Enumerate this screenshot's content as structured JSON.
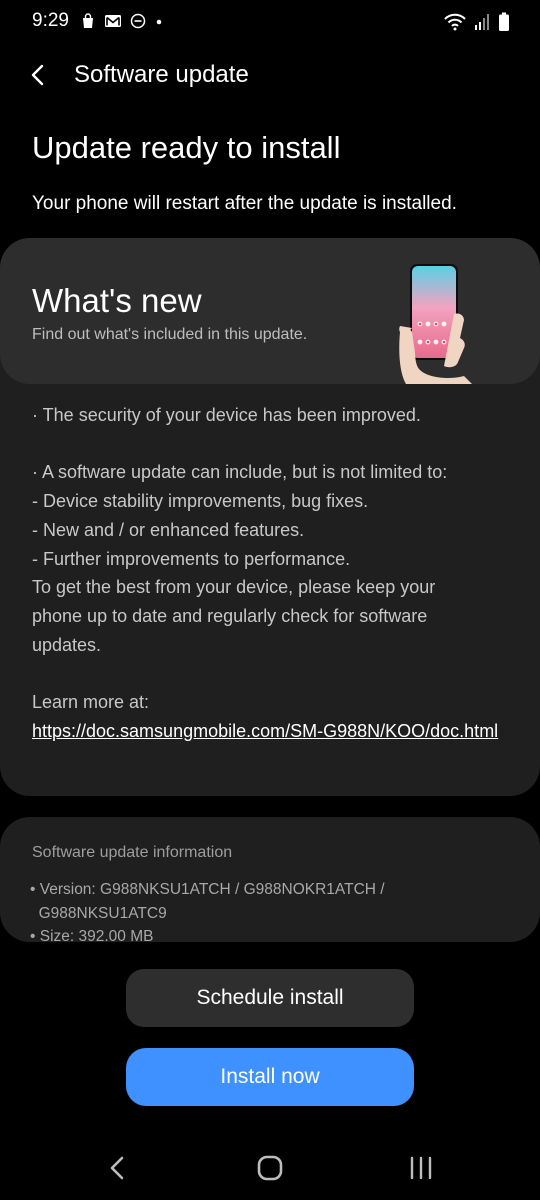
{
  "status_bar": {
    "time": "9:29",
    "left_icons": [
      "shopping-bag-icon",
      "gmail-icon",
      "do-not-disturb-icon",
      "dot-icon"
    ],
    "right_icons": [
      "wifi-icon",
      "signal-icon",
      "battery-icon"
    ]
  },
  "header": {
    "title": "Software update"
  },
  "headline": "Update ready to install",
  "subline": "Your phone will restart after the update is installed.",
  "whats_new": {
    "title": "What's new",
    "subtitle": "Find out what's included in this update.",
    "lines": {
      "security": "· The security of your device has been improved.",
      "intro": "· A software update can include, but is not limited to:",
      "item1": " - Device stability improvements, bug fixes.",
      "item2": " - New and / or enhanced features.",
      "item3": " - Further improvements to performance.",
      "advice1": "To get the best from your device, please keep your",
      "advice2": "phone up to date and regularly check for software",
      "advice3": "updates.",
      "learn_more": "Learn more at:",
      "link": "https://doc.samsungmobile.com/SM-G988N/KOO/doc.html"
    }
  },
  "info": {
    "title": "Software update information",
    "version_line1": "• Version: G988NKSU1ATCH / G988NOKR1ATCH /",
    "version_line2": "  G988NKSU1ATC9",
    "size": "• Size: 392.00 MB"
  },
  "buttons": {
    "schedule": "Schedule install",
    "install": "Install now"
  },
  "colors": {
    "background": "#000000",
    "card": "#1f1f1f",
    "card_header": "#2d2d2d",
    "accent": "#3e91ff"
  }
}
